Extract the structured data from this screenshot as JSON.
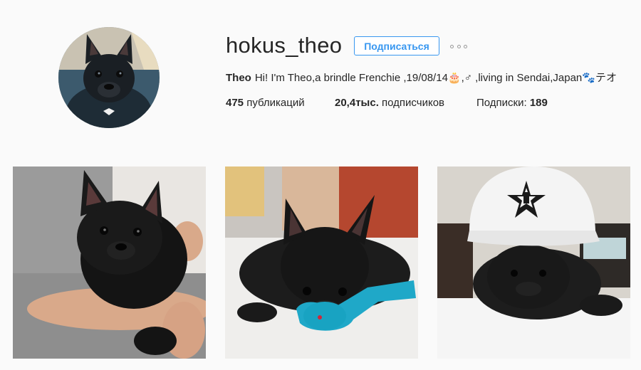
{
  "profile": {
    "username": "hokus_theo",
    "follow_label": "Подписаться",
    "more_icon": "ellipsis-icon",
    "bio_name": "Theo",
    "bio_text": "Hi! I'm Theo,a brindle Frenchie ,19/08/14🎂,♂ ,living in Sendai,Japan🐾テオ",
    "stats": {
      "posts_count": "475",
      "posts_label": "публикаций",
      "followers_count": "20,4тыс.",
      "followers_label": "подписчиков",
      "following_label": "Подписки:",
      "following_count": "189"
    }
  },
  "posts": [
    {
      "subject": "french-bulldog-held-in-arms"
    },
    {
      "subject": "french-bulldog-with-blue-toy"
    },
    {
      "subject": "french-bulldog-wearing-white-cap"
    }
  ]
}
